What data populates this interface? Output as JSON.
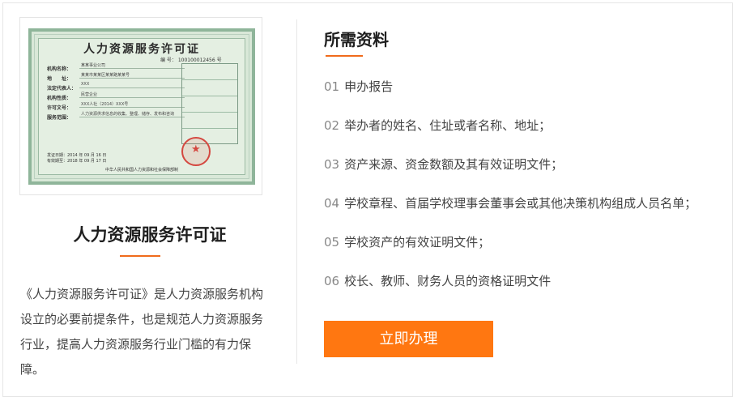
{
  "certificate_image": {
    "title": "人力资源服务许可证",
    "number_label": "编 号：",
    "number_value": "100100012456",
    "number_suffix": "号",
    "fields": [
      {
        "key": "机构名称：",
        "value": "某某事业公司"
      },
      {
        "key": "地　　址：",
        "value": "某某市某某区某某路某某号"
      },
      {
        "key": "法定代表人：",
        "value": "XXX"
      },
      {
        "key": "机构性质：",
        "value": "民营企业"
      },
      {
        "key": "许可文号：",
        "value": "XXX人社（2014）XXX号"
      },
      {
        "key": "服务范围：",
        "value": "人力资源供求信息的收集、整理、储存、发布和咨询"
      }
    ],
    "issue_date": "发证日期：2014 年 09 月 16 日",
    "valid_date": "有效期至：2018 年 09 月 17 日",
    "footer": "中华人民共和国人力资源和社会保障部制"
  },
  "left": {
    "title": "人力资源服务许可证",
    "description": "《人力资源服务许可证》是人力资源服务机构设立的必要前提条件，也是规范人力资源服务行业，提高人力资源服务行业门槛的有力保障。"
  },
  "right": {
    "title": "所需资料",
    "requirements": [
      {
        "num": "01",
        "text": "申办报告"
      },
      {
        "num": "02",
        "text": "举办者的姓名、住址或者名称、地址；"
      },
      {
        "num": "03",
        "text": "资产来源、资金数额及其有效证明文件；"
      },
      {
        "num": "04",
        "text": "学校章程、首届学校理事会董事会或其他决策机构组成人员名单；"
      },
      {
        "num": "05",
        "text": "学校资产的有效证明文件；"
      },
      {
        "num": "06",
        "text": "校长、教师、财务人员的资格证明文件"
      }
    ],
    "apply_label": "立即办理"
  },
  "colors": {
    "accent": "#f06b1b",
    "button": "#ff7711"
  }
}
